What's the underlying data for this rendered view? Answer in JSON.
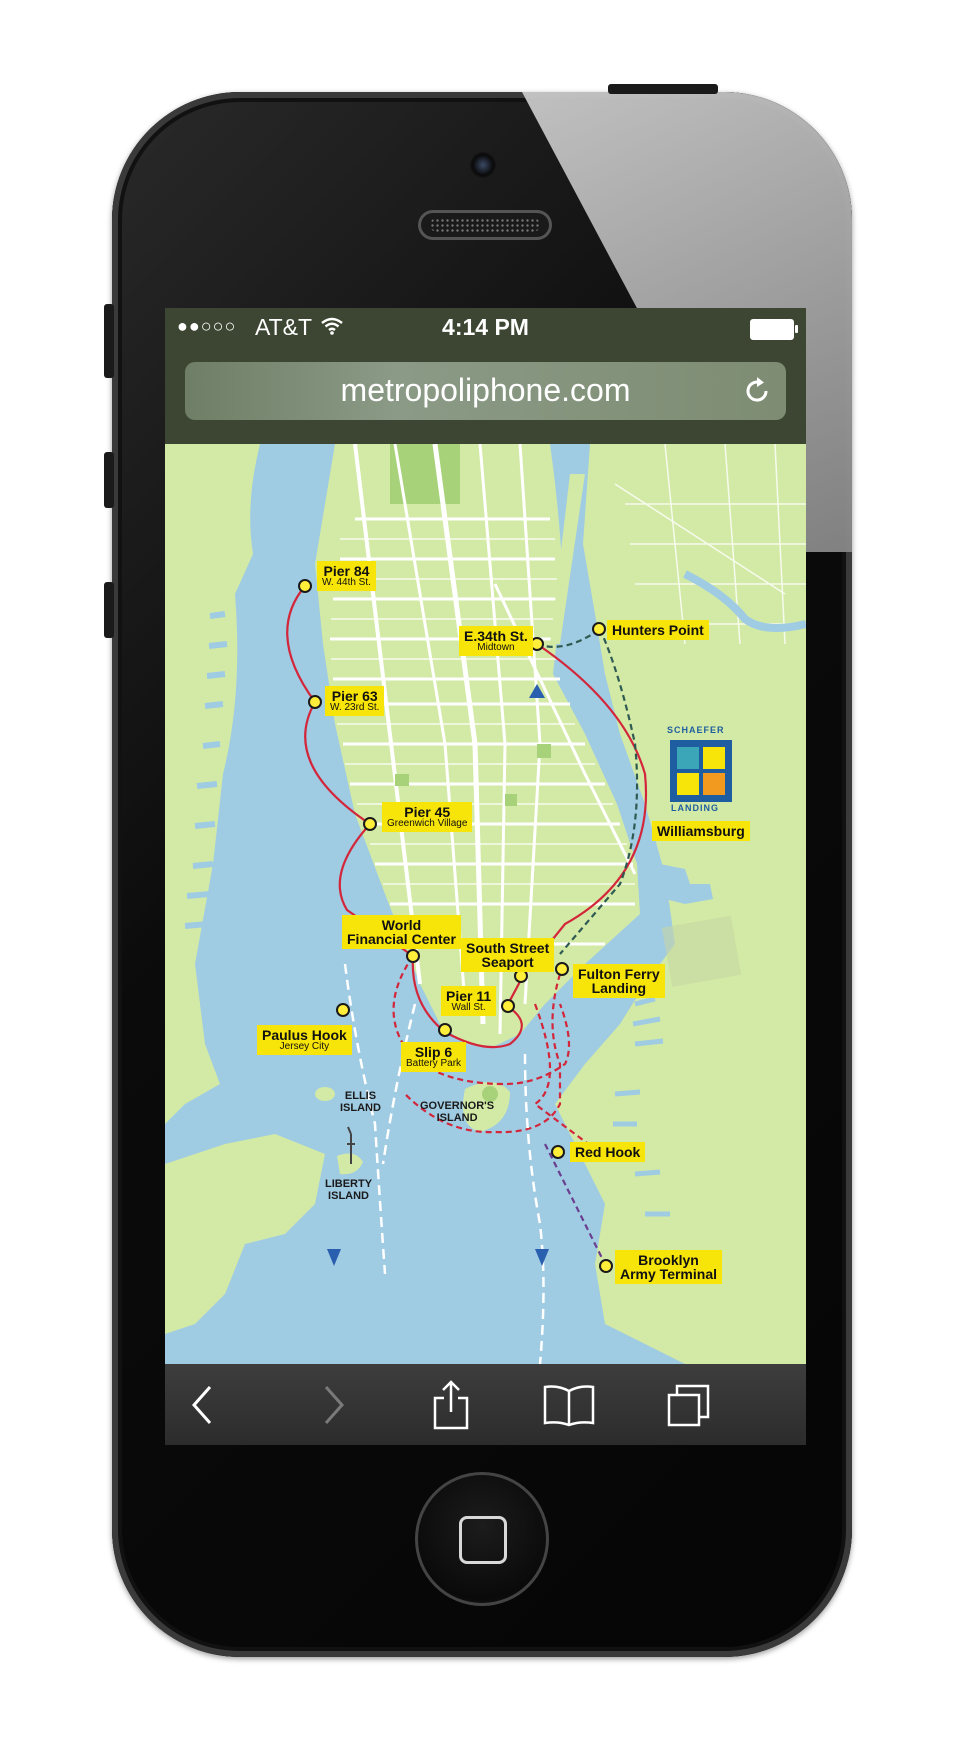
{
  "status_bar": {
    "signal": "●●○○○",
    "carrier": "AT&T",
    "time": "4:14 PM"
  },
  "address_bar": {
    "url": "metropoliphone.com"
  },
  "map": {
    "stops": [
      {
        "id": "pier84",
        "name": "Pier 84",
        "sub": "W. 44th St."
      },
      {
        "id": "pier63",
        "name": "Pier 63",
        "sub": "W. 23rd St."
      },
      {
        "id": "pier45",
        "name": "Pier 45",
        "sub": "Greenwich Village"
      },
      {
        "id": "wfc",
        "name": "World",
        "name2": "Financial Center"
      },
      {
        "id": "seaport",
        "name": "South Street",
        "name2": "Seaport"
      },
      {
        "id": "fulton",
        "name": "Fulton Ferry",
        "name2": "Landing"
      },
      {
        "id": "pier11",
        "name": "Pier 11",
        "sub": "Wall St."
      },
      {
        "id": "slip6",
        "name": "Slip 6",
        "sub": "Battery Park"
      },
      {
        "id": "paulus",
        "name": "Paulus Hook",
        "sub": "Jersey City"
      },
      {
        "id": "e34",
        "name": "E.34th St.",
        "sub": "Midtown"
      },
      {
        "id": "hunters",
        "name": "Hunters Point"
      },
      {
        "id": "williamsburg",
        "name": "Williamsburg"
      },
      {
        "id": "redhook",
        "name": "Red Hook"
      },
      {
        "id": "brooklyn",
        "name": "Brooklyn",
        "name2": "Army Terminal"
      }
    ],
    "places": {
      "ellis": [
        "ELLIS",
        "ISLAND"
      ],
      "governors": [
        "GOVERNOR'S",
        "ISLAND"
      ],
      "liberty": [
        "LIBERTY",
        "ISLAND"
      ]
    },
    "logo": {
      "top": "SCHAEFER",
      "bottom": "LANDING"
    },
    "colors": {
      "water": "#9fcbe3",
      "land": "#d3eaa6",
      "route_red": "#d3263a",
      "route_dark": "#2f5a52",
      "label": "#f7e409"
    }
  },
  "toolbar": {
    "items": [
      "back-icon",
      "forward-icon",
      "share-icon",
      "bookmarks-icon",
      "tabs-icon"
    ]
  }
}
